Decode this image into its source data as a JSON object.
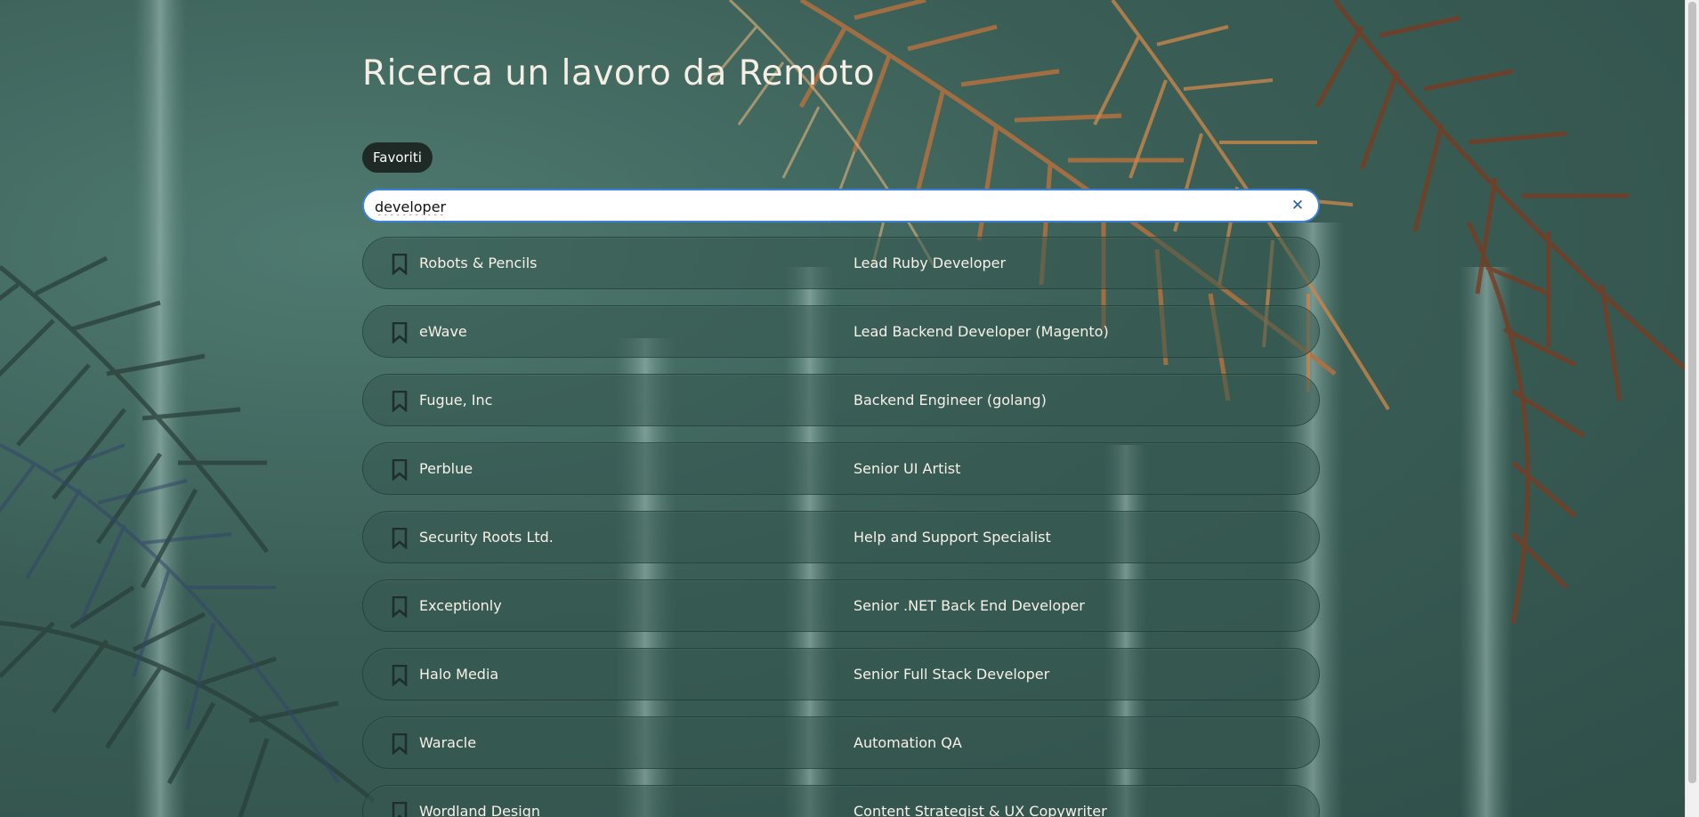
{
  "page": {
    "title": "Ricerca un lavoro da Remoto",
    "favorites_label": "Favoriti"
  },
  "search": {
    "value": "developer",
    "clear_icon": "close-icon"
  },
  "jobs": [
    {
      "company": "Robots & Pencils",
      "title": "Lead Ruby Developer",
      "icon": "bookmark-icon"
    },
    {
      "company": "eWave",
      "title": "Lead Backend Developer (Magento)",
      "icon": "bookmark-icon"
    },
    {
      "company": "Fugue, Inc",
      "title": "Backend Engineer (golang)",
      "icon": "bookmark-icon"
    },
    {
      "company": "Perblue",
      "title": "Senior UI Artist",
      "icon": "bookmark-icon"
    },
    {
      "company": "Security Roots Ltd.",
      "title": "Help and Support Specialist",
      "icon": "bookmark-icon"
    },
    {
      "company": "Exceptionly",
      "title": "Senior .NET Back End Developer",
      "icon": "bookmark-icon"
    },
    {
      "company": "Halo Media",
      "title": "Senior Full Stack Developer",
      "icon": "bookmark-icon"
    },
    {
      "company": "Waracle",
      "title": "Automation QA",
      "icon": "bookmark-icon"
    },
    {
      "company": "Wordland Design",
      "title": "Content Strategist & UX Copywriter",
      "icon": "bookmark-icon"
    }
  ],
  "colors": {
    "background": "#3d625b",
    "row": "#345850",
    "title_text": "#f5eee4",
    "bookmark": "#1f2e2a",
    "search_border": "#3b82d6",
    "clear_icon": "#2b5d96",
    "favorites_bg": "#1f2a27"
  }
}
